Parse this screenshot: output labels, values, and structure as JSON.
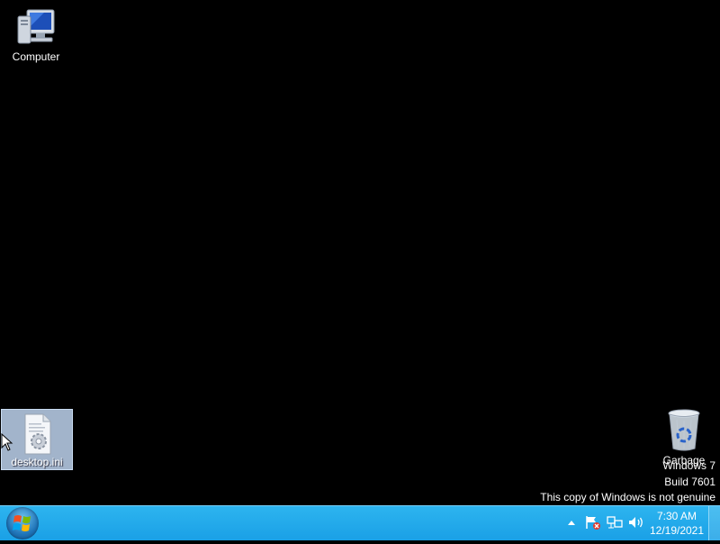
{
  "desktop": {
    "icons": [
      {
        "label": "Computer",
        "icon": "computer-icon"
      },
      {
        "label": "desktop.ini",
        "icon": "config-file-icon"
      },
      {
        "label": "Garbage",
        "icon": "recycle-bin-icon"
      }
    ],
    "watermark": {
      "line1": "Windows 7",
      "line2": "Build 7601",
      "line3": "This copy of Windows is not genuine"
    }
  },
  "taskbar": {
    "start_icon": "windows-logo-icon",
    "tray": {
      "icons": [
        "show-hidden-icons-icon",
        "action-center-flag-icon",
        "network-icon",
        "volume-icon"
      ],
      "time": "7:30 AM",
      "date": "12/19/2021"
    }
  },
  "colors": {
    "taskbar": "#1aa0e6",
    "desktop_background": "#000000",
    "selection": "#b4c8e1"
  }
}
